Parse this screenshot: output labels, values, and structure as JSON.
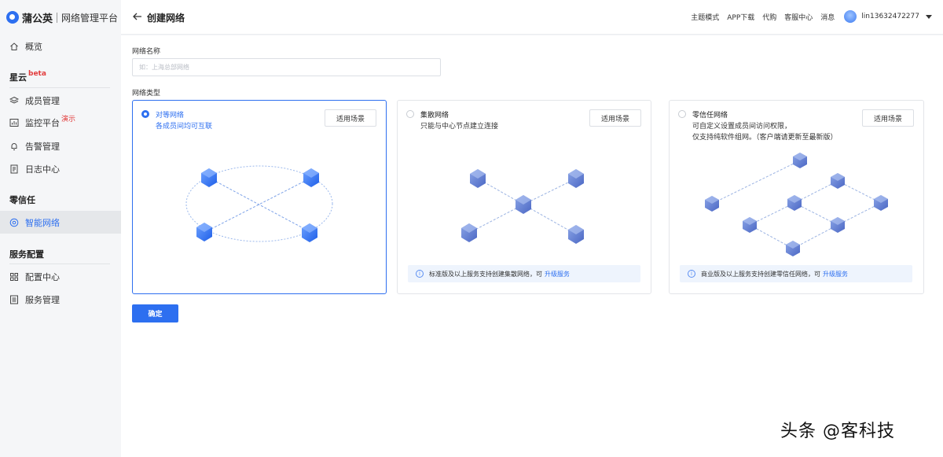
{
  "brand": {
    "name": "蒲公英",
    "subtitle": "网络管理平台"
  },
  "sidebar": {
    "overview": "概览",
    "section_xingyun": {
      "title": "星云",
      "tag": "beta"
    },
    "members": "成员管理",
    "monitor": {
      "label": "监控平台",
      "tag": "演示"
    },
    "alerts": "告警管理",
    "logs": "日志中心",
    "section_zerotrust": "零信任",
    "smart_network": "智能网络",
    "section_service": "服务配置",
    "config_center": "配置中心",
    "service_mgmt": "服务管理"
  },
  "header": {
    "title": "创建网络",
    "links": [
      "主题模式",
      "APP下载",
      "代购",
      "客服中心",
      "消息"
    ],
    "user": "lin13632472277"
  },
  "form": {
    "name_label": "网络名称",
    "name_placeholder": "如：上海总部网络",
    "type_label": "网络类型",
    "confirm": "确定"
  },
  "cards": [
    {
      "title": "对等网络",
      "desc": [
        "各成员间均可互联"
      ],
      "button": "适用场景",
      "selected": true
    },
    {
      "title": "集散网络",
      "desc": [
        "只能与中心节点建立连接"
      ],
      "button": "适用场景",
      "selected": false,
      "notice": "标准版及以上服务支持创建集散网络，可",
      "notice_link": "升级服务"
    },
    {
      "title": "零信任网络",
      "desc": [
        "可自定义设置成员间访问权限，",
        "仅支持纯软件组网。（客户端请更新至最新版）"
      ],
      "button": "适用场景",
      "selected": false,
      "notice": "商业版及以上服务支持创建零信任网络，可",
      "notice_link": "升级服务"
    }
  ],
  "watermark": "头条 @客科技",
  "colors": {
    "accent": "#2d6ff0",
    "node_blue": "#3f7bf0",
    "node_grey": "#6f86c9"
  }
}
